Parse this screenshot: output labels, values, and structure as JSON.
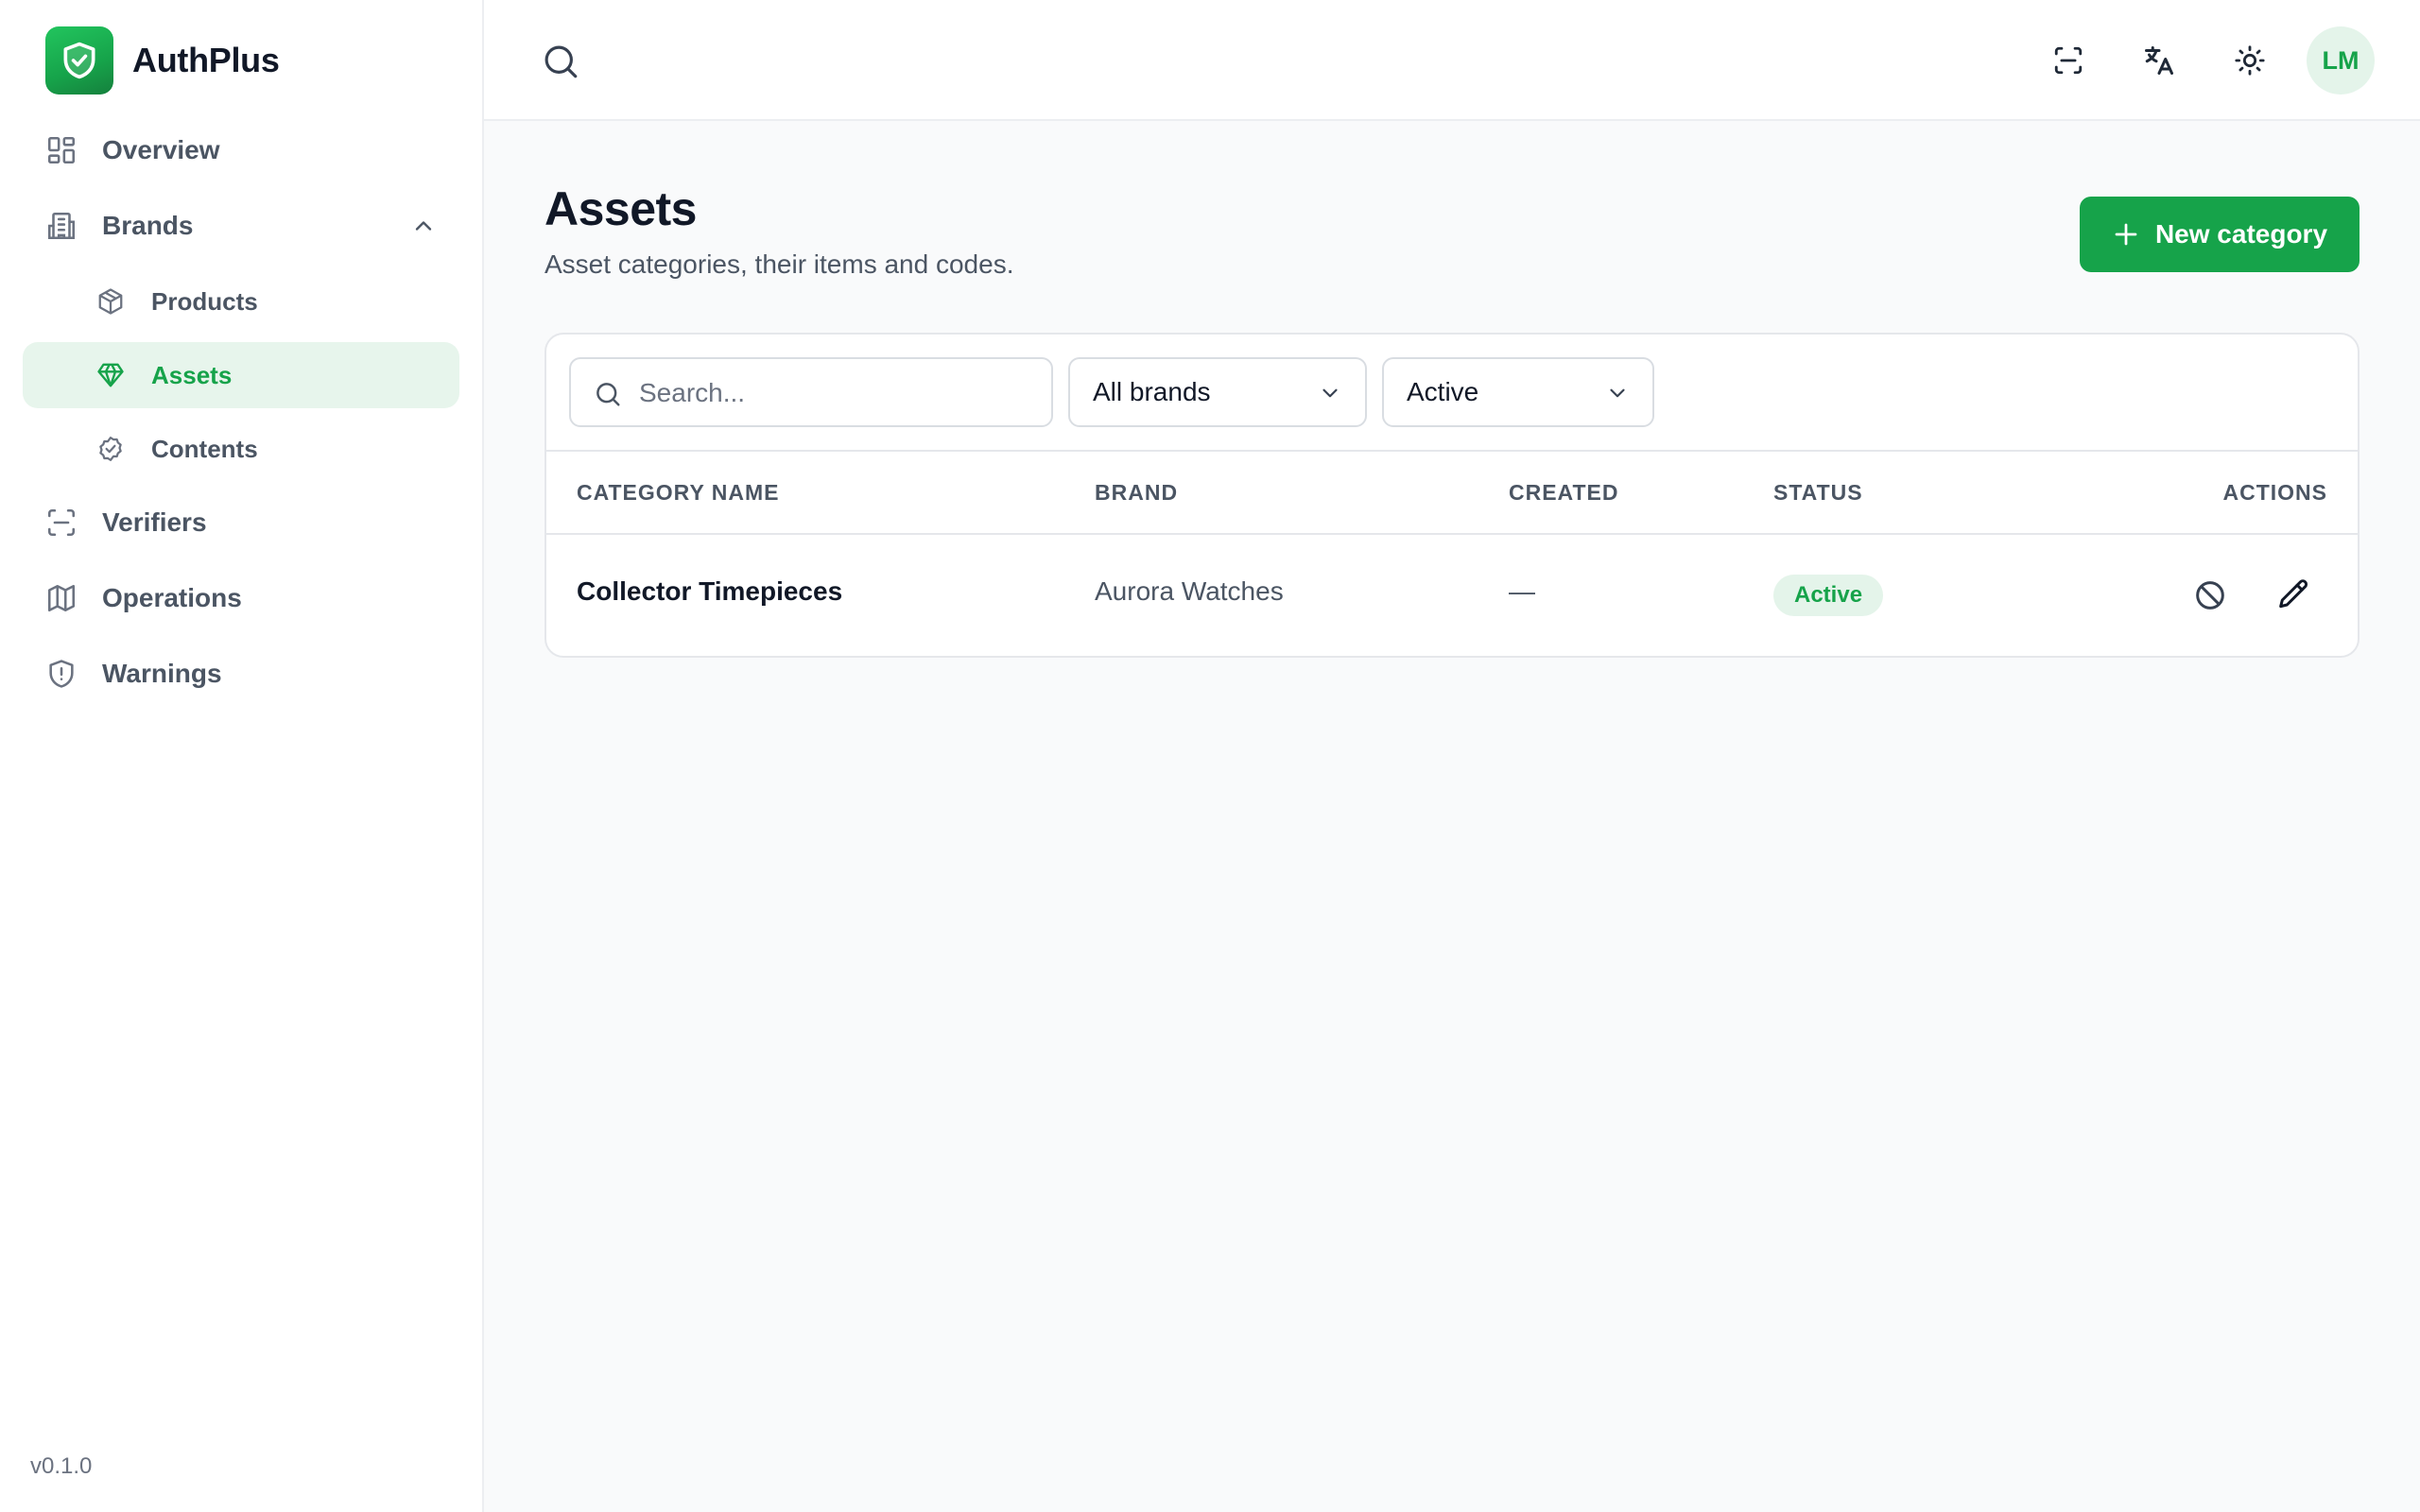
{
  "app": {
    "name": "AuthPlus",
    "version": "v0.1.0"
  },
  "sidebar": {
    "items": [
      {
        "label": "Overview",
        "icon": "grid-icon"
      },
      {
        "label": "Brands",
        "icon": "building-icon",
        "expanded": true
      },
      {
        "label": "Products",
        "icon": "box-icon"
      },
      {
        "label": "Assets",
        "icon": "gem-icon",
        "active": true
      },
      {
        "label": "Contents",
        "icon": "badge-check-icon"
      },
      {
        "label": "Verifiers",
        "icon": "scan-icon"
      },
      {
        "label": "Operations",
        "icon": "map-icon"
      },
      {
        "label": "Warnings",
        "icon": "shield-alert-icon"
      }
    ]
  },
  "topbar": {
    "avatar_initials": "LM",
    "icons": [
      "search-icon",
      "scan-icon",
      "translate-icon",
      "sun-icon"
    ]
  },
  "page": {
    "title": "Assets",
    "subtitle": "Asset categories, their items and codes.",
    "new_button_label": "New category"
  },
  "filters": {
    "search_placeholder": "Search...",
    "brand_select": "All brands",
    "status_select": "Active"
  },
  "table": {
    "columns": [
      "CATEGORY NAME",
      "BRAND",
      "CREATED",
      "STATUS",
      "ACTIONS"
    ],
    "rows": [
      {
        "name": "Collector Timepieces",
        "brand": "Aurora Watches",
        "created": "—",
        "status": "Active"
      }
    ]
  },
  "colors": {
    "accent": "#16a34a",
    "accent_light": "#e4f4ea",
    "background": "#f9fafb"
  }
}
